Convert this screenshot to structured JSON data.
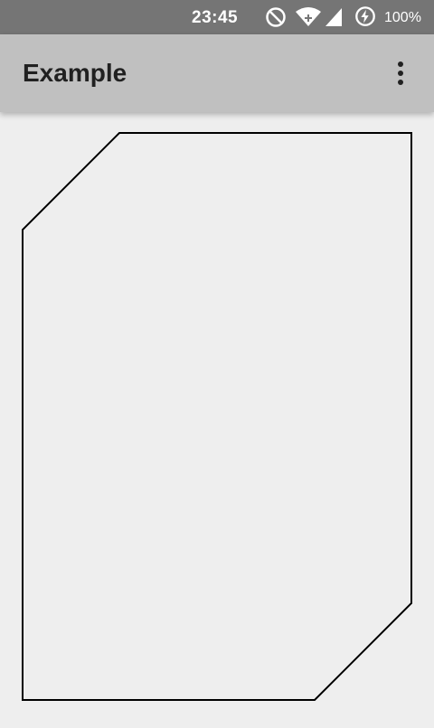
{
  "status_bar": {
    "time": "23:45",
    "battery_percent": "100%",
    "icons": [
      "do-not-disturb-icon",
      "wifi-icon",
      "signal-icon",
      "battery-charging-icon"
    ],
    "background": "#757575"
  },
  "app_bar": {
    "title": "Example",
    "menu_icon": "overflow-menu-icon",
    "background": "#c0c0c0"
  },
  "content": {
    "shape": "chamfered-rectangle-outline",
    "stroke_color": "#000000",
    "background": "#eeeeee"
  }
}
